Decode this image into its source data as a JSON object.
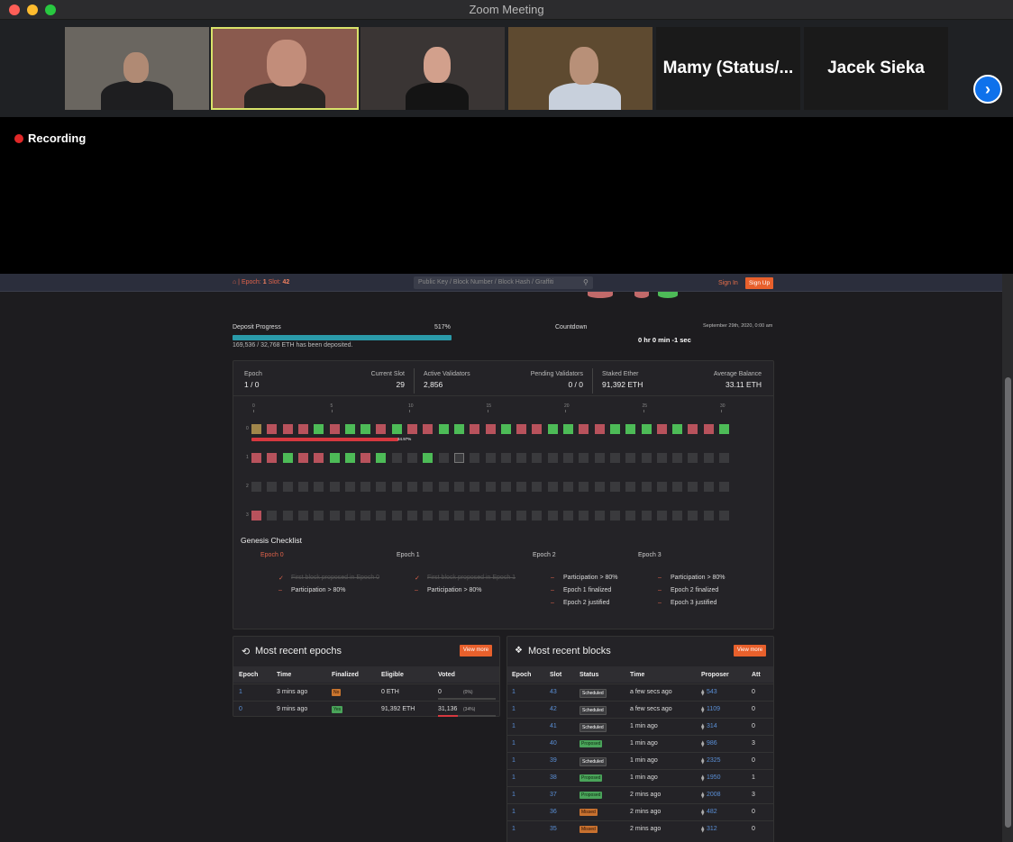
{
  "window": {
    "title": "Zoom Meeting"
  },
  "participants": {
    "name_tiles": [
      "Mamy (Status/...",
      "Jacek Sieka"
    ]
  },
  "recording": {
    "label": "Recording"
  },
  "nav": {
    "epoch_label": "Epoch:",
    "epoch_value": "1",
    "slot_label": "Slot:",
    "slot_value": "42",
    "search_placeholder": "Public Key / Block Number / Block Hash / Graffiti",
    "sign_in": "Sign In",
    "sign_up": "Sign Up"
  },
  "deposit": {
    "label": "Deposit Progress",
    "percent": "517%",
    "fill_fraction": 1.0,
    "subtext": "169,536 / 32,768 ETH has been deposited.",
    "countdown_label": "Countdown",
    "countdown_date": "September 29th, 2020, 0:00 am",
    "countdown_value": "0 hr 0 min -1 sec"
  },
  "stats": {
    "epoch_label": "Epoch",
    "epoch_value": "1 / 0",
    "current_slot_label": "Current Slot",
    "current_slot_value": "29",
    "active_validators_label": "Active Validators",
    "active_validators_value": "2,856",
    "pending_validators_label": "Pending Validators",
    "pending_validators_value": "0 / 0",
    "staked_ether_label": "Staked Ether",
    "staked_ether_value": "91,392 ETH",
    "average_balance_label": "Average Balance",
    "average_balance_value": "33.11 ETH"
  },
  "slot_grid": {
    "ticks": [
      "0",
      "5",
      "10",
      "15",
      "20",
      "25",
      "30"
    ],
    "row_labels": [
      "0",
      "1",
      "2",
      "3"
    ],
    "participation_label": "34.97%",
    "participation_fraction": 0.3497,
    "rows": [
      "yrrrgrggrgrrggrrgrrggrrgggrgrrg",
      "rrgrrggrgddgddddddddddddddddddd",
      "ddddddddddddddddddddddddddddddd",
      "rdddddddddddddddddddddddddddddd"
    ]
  },
  "checklist": {
    "title": "Genesis Checklist",
    "columns": [
      {
        "header": "Epoch 0",
        "items": [
          {
            "text": "First block proposed in Epoch 0",
            "done": true
          },
          {
            "text": "Participation > 80%",
            "done": false
          }
        ]
      },
      {
        "header": "Epoch 1",
        "items": [
          {
            "text": "First block proposed in Epoch 1",
            "done": true
          },
          {
            "text": "Participation > 80%",
            "done": false
          }
        ]
      },
      {
        "header": "Epoch 2",
        "items": [
          {
            "text": "Participation > 80%",
            "done": false
          },
          {
            "text": "Epoch 1 finalized",
            "done": false
          },
          {
            "text": "Epoch 2 justified",
            "done": false
          }
        ]
      },
      {
        "header": "Epoch 3",
        "items": [
          {
            "text": "Participation > 80%",
            "done": false
          },
          {
            "text": "Epoch 2 finalized",
            "done": false
          },
          {
            "text": "Epoch 3 justified",
            "done": false
          }
        ]
      }
    ]
  },
  "epochs_panel": {
    "title": "Most recent epochs",
    "view_more": "View more",
    "columns": [
      "Epoch",
      "Time",
      "Finalized",
      "Eligible",
      "Voted"
    ],
    "rows": [
      {
        "epoch": "1",
        "time": "3 mins ago",
        "finalized": "No",
        "eligible": "0 ETH",
        "voted": "0",
        "voted_pct": "(0%)",
        "fraction": 0.0
      },
      {
        "epoch": "0",
        "time": "9 mins ago",
        "finalized": "Yes",
        "eligible": "91,392 ETH",
        "voted": "31,136",
        "voted_pct": "(34%)",
        "fraction": 0.34
      }
    ]
  },
  "blocks_panel": {
    "title": "Most recent blocks",
    "view_more": "View more",
    "columns": [
      "Epoch",
      "Slot",
      "Status",
      "Time",
      "Proposer",
      "Att"
    ],
    "rows": [
      {
        "epoch": "1",
        "slot": "43",
        "status": "Scheduled",
        "time": "a few secs ago",
        "proposer": "543",
        "att": "0"
      },
      {
        "epoch": "1",
        "slot": "42",
        "status": "Scheduled",
        "time": "a few secs ago",
        "proposer": "1109",
        "att": "0"
      },
      {
        "epoch": "1",
        "slot": "41",
        "status": "Scheduled",
        "time": "1 min ago",
        "proposer": "314",
        "att": "0"
      },
      {
        "epoch": "1",
        "slot": "40",
        "status": "Proposed",
        "time": "1 min ago",
        "proposer": "986",
        "att": "3"
      },
      {
        "epoch": "1",
        "slot": "39",
        "status": "Scheduled",
        "time": "1 min ago",
        "proposer": "2325",
        "att": "0"
      },
      {
        "epoch": "1",
        "slot": "38",
        "status": "Proposed",
        "time": "1 min ago",
        "proposer": "1950",
        "att": "1"
      },
      {
        "epoch": "1",
        "slot": "37",
        "status": "Proposed",
        "time": "2 mins ago",
        "proposer": "2008",
        "att": "3"
      },
      {
        "epoch": "1",
        "slot": "36",
        "status": "Missed",
        "time": "2 mins ago",
        "proposer": "482",
        "att": "0"
      },
      {
        "epoch": "1",
        "slot": "35",
        "status": "Missed",
        "time": "2 mins ago",
        "proposer": "312",
        "att": "0"
      }
    ]
  },
  "colors": {
    "accent": "#e8602c",
    "proposed": "#4dbb57",
    "missed": "#b8525c",
    "link": "#5a8fd6"
  }
}
